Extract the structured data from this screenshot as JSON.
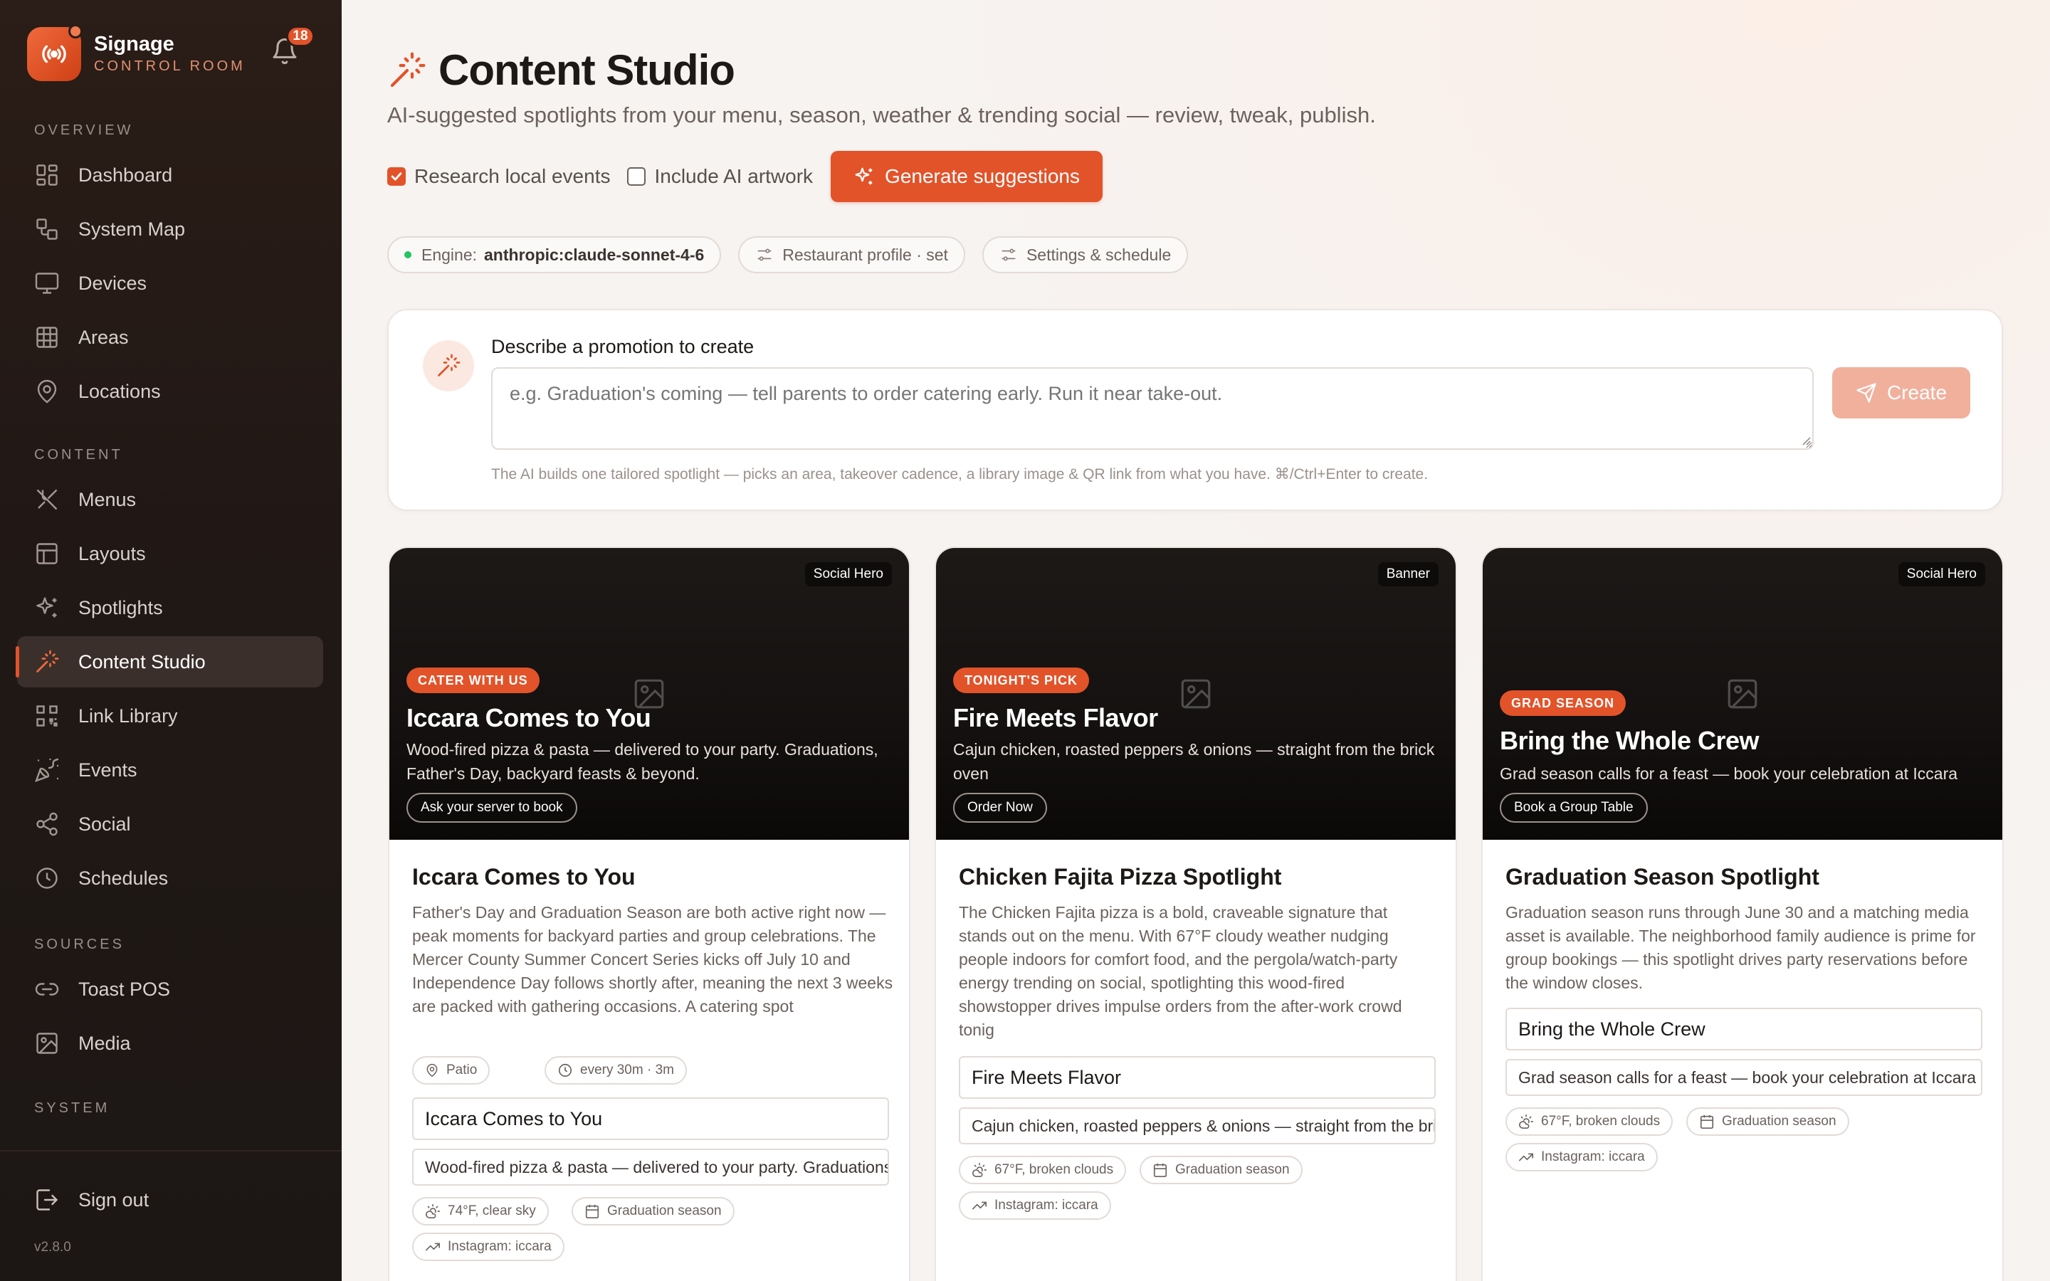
{
  "brand": {
    "name": "Signage",
    "subtitle": "CONTROL ROOM",
    "notifications": "18"
  },
  "nav": {
    "overview_label": "OVERVIEW",
    "content_label": "CONTENT",
    "sources_label": "SOURCES",
    "system_label": "SYSTEM",
    "items": [
      {
        "label": "Dashboard",
        "icon": "dashboard-icon"
      },
      {
        "label": "System Map",
        "icon": "system-map-icon"
      },
      {
        "label": "Devices",
        "icon": "monitor-icon"
      },
      {
        "label": "Areas",
        "icon": "grid-icon"
      },
      {
        "label": "Locations",
        "icon": "map-pin-icon"
      },
      {
        "label": "Menus",
        "icon": "utensils-icon"
      },
      {
        "label": "Layouts",
        "icon": "layout-icon"
      },
      {
        "label": "Spotlights",
        "icon": "sparkles-icon"
      },
      {
        "label": "Content Studio",
        "icon": "magic-wand-icon"
      },
      {
        "label": "Link Library",
        "icon": "qr-code-icon"
      },
      {
        "label": "Events",
        "icon": "party-popper-icon"
      },
      {
        "label": "Social",
        "icon": "share-icon"
      },
      {
        "label": "Schedules",
        "icon": "clock-icon"
      },
      {
        "label": "Toast POS",
        "icon": "link-icon"
      },
      {
        "label": "Media",
        "icon": "image-icon"
      }
    ],
    "sign_out": "Sign out",
    "version": "v2.8.0",
    "active": "Content Studio"
  },
  "page": {
    "title": "Content Studio",
    "subtitle": "AI-suggested spotlights from your menu, season, weather & trending social — review, tweak, publish."
  },
  "controls": {
    "research_label": "Research local events",
    "research_checked": true,
    "artwork_label": "Include AI artwork",
    "artwork_checked": false,
    "generate_label": "Generate suggestions"
  },
  "chips": {
    "engine_label": "Engine:",
    "engine_value": "anthropic:claude-sonnet-4-6",
    "profile": "Restaurant profile · set",
    "settings": "Settings & schedule"
  },
  "prompt": {
    "label": "Describe a promotion to create",
    "placeholder": "e.g. Graduation's coming — tell parents to order catering early. Run it near take-out.",
    "value": "",
    "create_label": "Create",
    "hint": "The AI builds one tailored spotlight — picks an area, takeover cadence, a library image & QR link from what you have. ⌘/Ctrl+Enter to create."
  },
  "accent_color": "#e2532a",
  "cards": [
    {
      "hero_type": "Social Hero",
      "tag": "CATER WITH US",
      "hero_title": "Iccara Comes to You",
      "hero_body": "Wood-fired pizza & pasta — delivered to your party. Graduations, Father's Day, backyard feasts & beyond.",
      "cta": "Ask your server to book",
      "title": "Iccara Comes to You",
      "description": "Father's Day and Graduation Season are both active right now — peak moments for backyard parties and group celebrations. The Mercer County Summer Concert Series kicks off July 10 and Independence Day follows shortly after, meaning the next 3 weeks are packed with gathering occasions. A catering spot",
      "area": "Patio",
      "cadence": "every 30m · 3m",
      "headline_value": "Iccara Comes to You",
      "subline_value": "Wood-fired pizza & pasta — delivered to your party. Graduations, Father's Day, backyard feasts & beyond.",
      "weather": "74°F, clear sky",
      "season": "Graduation season",
      "trend": "Instagram: iccara"
    },
    {
      "hero_type": "Banner",
      "tag": "TONIGHT'S PICK",
      "hero_title": "Fire Meets Flavor",
      "hero_body": "Cajun chicken, roasted peppers & onions — straight from the brick oven",
      "cta": "Order Now",
      "title": "Chicken Fajita Pizza Spotlight",
      "description": "The Chicken Fajita pizza is a bold, craveable signature that stands out on the menu. With 67°F cloudy weather nudging people indoors for comfort food, and the pergola/watch-party energy trending on social, spotlighting this wood-fired showstopper drives impulse orders from the after-work crowd tonig",
      "headline_value": "Fire Meets Flavor",
      "subline_value": "Cajun chicken, roasted peppers & onions — straight from the brick oven",
      "weather": "67°F, broken clouds",
      "season": "Graduation season",
      "trend": "Instagram: iccara"
    },
    {
      "hero_type": "Social Hero",
      "tag": "GRAD SEASON",
      "hero_title": "Bring the Whole Crew",
      "hero_body": "Grad season calls for a feast — book your celebration at Iccara",
      "cta": "Book a Group Table",
      "title": "Graduation Season Spotlight",
      "description": "Graduation season runs through June 30 and a matching media asset is available. The neighborhood family audience is prime for group bookings — this spotlight drives party reservations before the window closes.",
      "headline_value": "Bring the Whole Crew",
      "subline_value": "Grad season calls for a feast — book your celebration at Iccara",
      "weather": "67°F, broken clouds",
      "season": "Graduation season",
      "trend": "Instagram: iccara"
    }
  ]
}
